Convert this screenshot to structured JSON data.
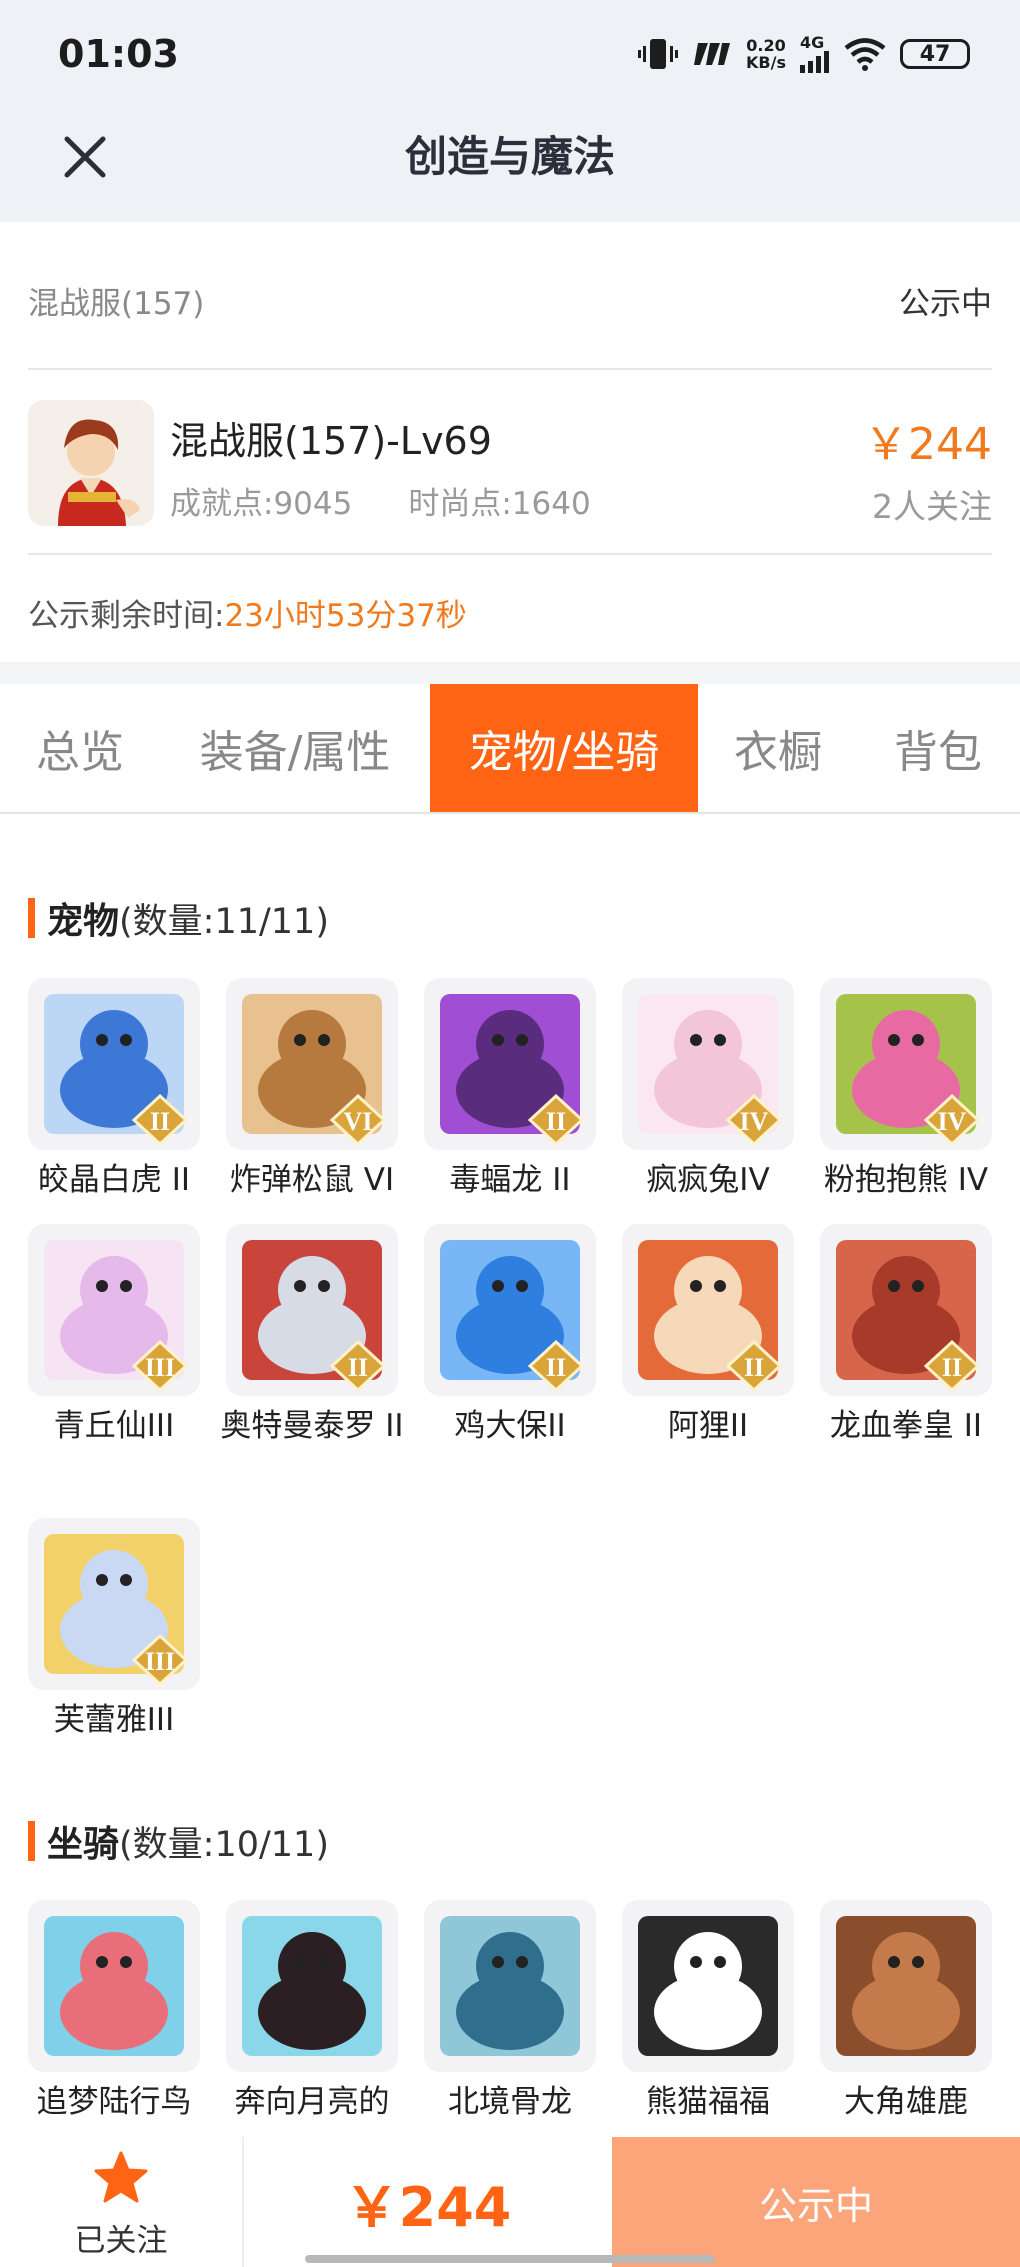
{
  "status_bar": {
    "time": "01:03",
    "net_speed_value": "0.20",
    "net_speed_unit": "KB/s",
    "network_type": "4G",
    "battery": "47"
  },
  "nav": {
    "title": "创造与魔法",
    "close_icon": "close-icon"
  },
  "server": {
    "name": "混战服(157)",
    "status": "公示中"
  },
  "character": {
    "name": "混战服(157)-Lv69",
    "achievement": "成就点:9045",
    "fashion": "时尚点:1640",
    "price": "￥244",
    "followers": "2人关注"
  },
  "remaining": {
    "label": "公示剩余时间:",
    "value": "23小时53分37秒"
  },
  "tabs": [
    {
      "label": "总览"
    },
    {
      "label": "装备/属性"
    },
    {
      "label": "宠物/坐骑"
    },
    {
      "label": "衣橱"
    },
    {
      "label": "背包"
    }
  ],
  "active_tab": "宠物/坐骑",
  "pets": {
    "title": "宠物",
    "count": "(数量:11/11)",
    "items": [
      {
        "label": "皎晶白虎 II",
        "rank": "II",
        "colors": [
          "#3d78d6",
          "#bcd6f5"
        ]
      },
      {
        "label": "炸弹松鼠 VI",
        "rank": "VI",
        "colors": [
          "#b67a3e",
          "#e8c18e"
        ]
      },
      {
        "label": "毒蝠龙 II",
        "rank": "II",
        "colors": [
          "#5a2c7e",
          "#a04fd4"
        ]
      },
      {
        "label": "疯疯兔IV",
        "rank": "IV",
        "colors": [
          "#f2c6d8",
          "#fbe7ef"
        ]
      },
      {
        "label": "粉抱抱熊 IV",
        "rank": "IV",
        "colors": [
          "#e86aa3",
          "#a5c24a"
        ]
      },
      {
        "label": "青丘仙III",
        "rank": "III",
        "colors": [
          "#e5b9e9",
          "#f6e3f4"
        ]
      },
      {
        "label": "奥特曼泰罗 II",
        "rank": "II",
        "colors": [
          "#d7dbe6",
          "#c9443b"
        ]
      },
      {
        "label": "鸡大保II",
        "rank": "II",
        "colors": [
          "#2f7fe0",
          "#79b6f5"
        ]
      },
      {
        "label": "阿狸II",
        "rank": "II",
        "colors": [
          "#f5d9b8",
          "#e46a3a"
        ]
      },
      {
        "label": "龙血拳皇 II",
        "rank": "II",
        "colors": [
          "#a83a2a",
          "#d6654a"
        ]
      },
      {
        "label": "芙蕾雅III",
        "rank": "III",
        "colors": [
          "#c9d8f3",
          "#f2d16b"
        ]
      }
    ]
  },
  "mounts": {
    "title": "坐骑",
    "count": "(数量:10/11)",
    "items": [
      {
        "label": "追梦陆行鸟",
        "colors": [
          "#e86f7a",
          "#7fd0e8"
        ]
      },
      {
        "label": "奔向月亮的",
        "colors": [
          "#2b1f24",
          "#8ad7ea"
        ]
      },
      {
        "label": "北境骨龙",
        "colors": [
          "#2f6f8d",
          "#8fc7d8"
        ]
      },
      {
        "label": "熊猫福福",
        "colors": [
          "#ffffff",
          "#2a2a2a"
        ]
      },
      {
        "label": "大角雄鹿",
        "colors": [
          "#c47a4a",
          "#8a4e2c"
        ]
      }
    ]
  },
  "bottom": {
    "follow_label": "已关注",
    "star_icon": "star-icon",
    "price": "￥244",
    "status_button": "公示中"
  }
}
